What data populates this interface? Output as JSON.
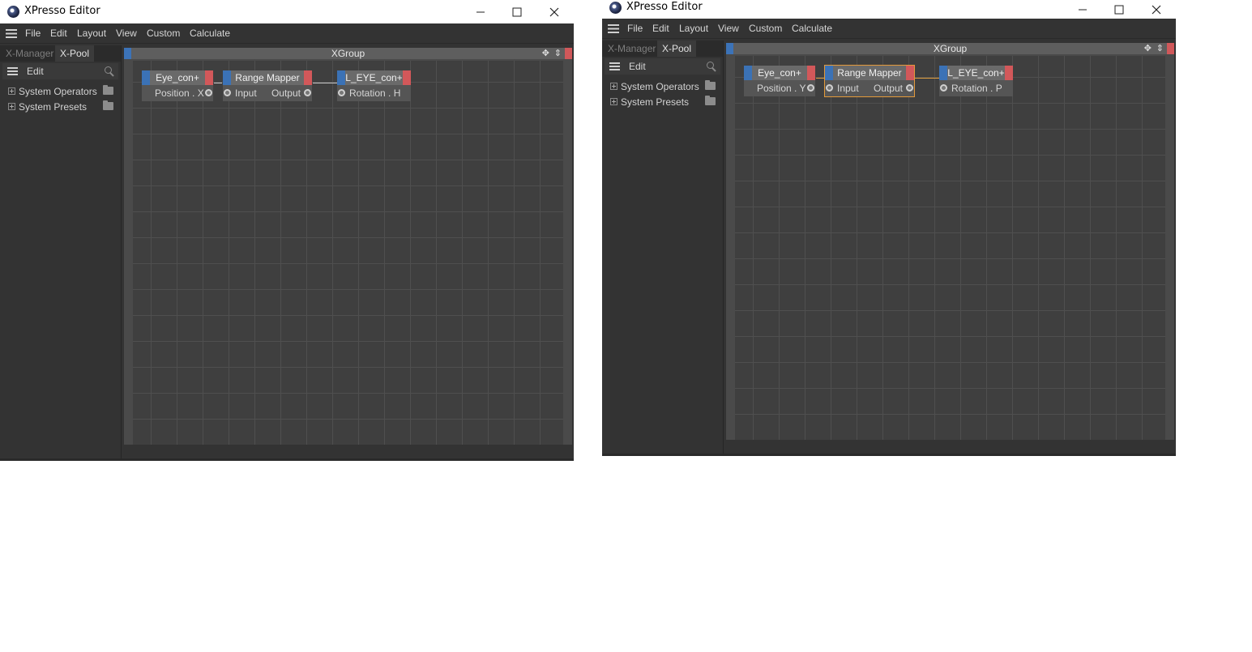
{
  "windows": [
    {
      "title": "XPresso Editor",
      "menu": [
        "File",
        "Edit",
        "Layout",
        "View",
        "Custom",
        "Calculate"
      ],
      "tabs": [
        "X-Manager",
        "X-Pool"
      ],
      "active_tab": "X-Pool",
      "panel_menu": "Edit",
      "tree": [
        "System Operators",
        "System Presets"
      ],
      "group_title": "XGroup",
      "nodes": [
        {
          "title": "Eye_con+",
          "ports": [
            "Position . X"
          ]
        },
        {
          "title": "Range Mapper",
          "ports": [
            "Input",
            "Output"
          ]
        },
        {
          "title": "L_EYE_con+",
          "ports": [
            "Rotation . H"
          ]
        }
      ],
      "wire_color": "#c8c8c8"
    },
    {
      "title": "XPresso Editor",
      "menu": [
        "File",
        "Edit",
        "Layout",
        "View",
        "Custom",
        "Calculate"
      ],
      "tabs": [
        "X-Manager",
        "X-Pool"
      ],
      "active_tab": "X-Pool",
      "panel_menu": "Edit",
      "tree": [
        "System Operators",
        "System Presets"
      ],
      "group_title": "XGroup",
      "nodes": [
        {
          "title": "Eye_con+",
          "ports": [
            "Position . Y"
          ]
        },
        {
          "title": "Range Mapper",
          "ports": [
            "Input",
            "Output"
          ],
          "selected": true
        },
        {
          "title": "L_EYE_con+",
          "ports": [
            "Rotation . P"
          ]
        }
      ],
      "wire_color": "#e0a040"
    }
  ]
}
